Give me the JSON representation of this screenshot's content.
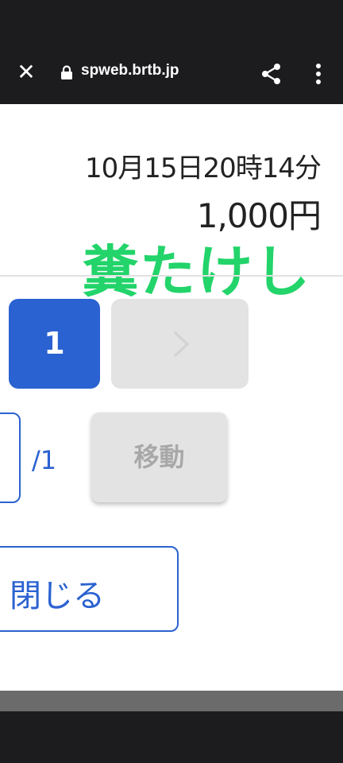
{
  "browser": {
    "url": "spweb.brtb.jp",
    "close_icon": "close-icon",
    "lock_icon": "lock-icon",
    "share_icon": "share-icon",
    "menu_icon": "more-vert-icon"
  },
  "ticket": {
    "datetime": "10月15日20時14分",
    "price": "1,000円"
  },
  "overlay_text": "糞たけし",
  "pagination": {
    "current_page": "1",
    "next_icon": "chevron-right-icon",
    "total": "/1",
    "move_label": "移動"
  },
  "close_label": "閉じる",
  "colors": {
    "accent": "#2b62d1",
    "overlay_green": "#22d46a",
    "disabled_bg": "#e3e3e3",
    "topbar": "#1c1c1f"
  }
}
